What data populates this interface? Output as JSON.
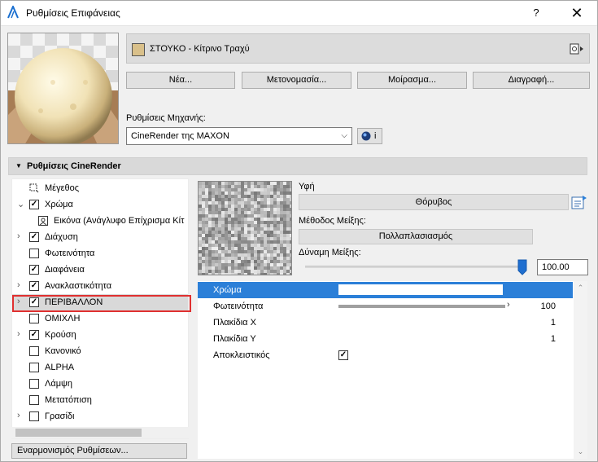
{
  "window": {
    "title": "Ρυθμίσεις Επιφάνειας",
    "help_label": "?",
    "close_label": "✕"
  },
  "material": {
    "name": "ΣΤΟΥΚΟ - Κίτρινο Τραχύ",
    "swatch_color": "#d9c08a"
  },
  "buttons": {
    "new": "Νέα...",
    "rename": "Μετονομασία...",
    "share": "Μοίρασμα...",
    "delete": "Διαγραφή..."
  },
  "engine": {
    "label": "Ρυθμίσεις Μηχανής:",
    "value": "CineRender της MAXON",
    "info_label": "i"
  },
  "section": {
    "title": "Ρυθμίσεις CineRender"
  },
  "tree": [
    {
      "label": "Μέγεθος",
      "icon": "size-icon",
      "checked": null,
      "expander": "",
      "indent": 0
    },
    {
      "label": "Χρώμα",
      "checked": true,
      "expander": "⌄",
      "indent": 0
    },
    {
      "label": "Εικόνα (Ανάγλυφο Επίχρισμα Κίτ",
      "icon": "image-icon",
      "checked": null,
      "expander": "",
      "indent": 1
    },
    {
      "label": "Διάχυση",
      "checked": true,
      "expander": "›",
      "indent": 0
    },
    {
      "label": "Φωτεινότητα",
      "checked": false,
      "expander": "",
      "indent": 0
    },
    {
      "label": "Διαφάνεια",
      "checked": true,
      "expander": "",
      "indent": 0
    },
    {
      "label": "Ανακλαστικότητα",
      "checked": true,
      "expander": "›",
      "indent": 0
    },
    {
      "label": "ΠΕΡΙΒΑΛΛΟΝ",
      "checked": true,
      "expander": "›",
      "indent": 0,
      "selected": true
    },
    {
      "label": "ΟΜΙΧΛΗ",
      "checked": false,
      "expander": "",
      "indent": 0
    },
    {
      "label": "Κρούση",
      "checked": true,
      "expander": "›",
      "indent": 0
    },
    {
      "label": "Κανονικό",
      "checked": false,
      "expander": "",
      "indent": 0
    },
    {
      "label": "ALPHA",
      "checked": false,
      "expander": "",
      "indent": 0
    },
    {
      "label": "Λάμψη",
      "checked": false,
      "expander": "",
      "indent": 0
    },
    {
      "label": "Μετατόπιση",
      "checked": false,
      "expander": "",
      "indent": 0
    },
    {
      "label": "Γρασίδι",
      "checked": false,
      "expander": "›",
      "indent": 0
    }
  ],
  "harmonize_label": "Εναρμονισμός Ρυθμίσεων...",
  "texture": {
    "label": "Υφή",
    "value": "Θόρυβος"
  },
  "blend": {
    "label": "Μέθοδος Μείξης:",
    "value": "Πολλαπλασιασμός"
  },
  "strength": {
    "label": "Δύναμη Μείξης:",
    "value": "100.00",
    "level": 1.0
  },
  "params": [
    {
      "label": "Χρώμα",
      "value": "",
      "kind": "color"
    },
    {
      "label": "Φωτεινότητα",
      "value": "100",
      "kind": "slider"
    },
    {
      "label": "Πλακίδια Χ",
      "value": "1",
      "kind": "number"
    },
    {
      "label": "Πλακίδια Υ",
      "value": "1",
      "kind": "number"
    },
    {
      "label": "Αποκλειστικός",
      "value": "",
      "kind": "checkbox",
      "checked": true
    }
  ],
  "colors": {
    "selection": "#2b7fd8",
    "highlight_box": "#e03030"
  }
}
